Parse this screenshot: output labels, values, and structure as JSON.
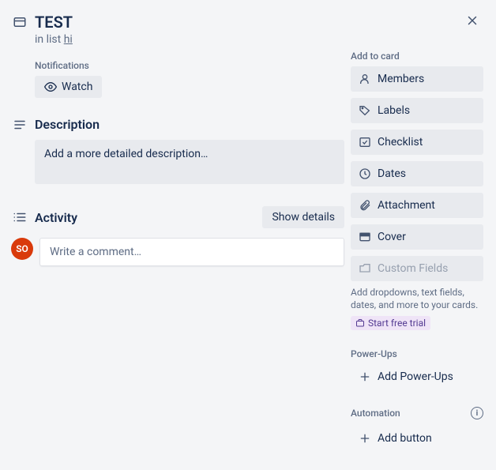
{
  "card": {
    "title": "TEST",
    "in_list_prefix": "in list ",
    "list_name": "hi"
  },
  "notifications": {
    "label": "Notifications",
    "watch": "Watch"
  },
  "description": {
    "heading": "Description",
    "placeholder": "Add a more detailed description…"
  },
  "activity": {
    "heading": "Activity",
    "show_details": "Show details",
    "avatar_initials": "SO",
    "comment_placeholder": "Write a comment…"
  },
  "sidebar": {
    "add_to_card": "Add to card",
    "items": [
      {
        "label": "Members"
      },
      {
        "label": "Labels"
      },
      {
        "label": "Checklist"
      },
      {
        "label": "Dates"
      },
      {
        "label": "Attachment"
      },
      {
        "label": "Cover"
      },
      {
        "label": "Custom Fields"
      }
    ],
    "custom_fields_hint": "Add dropdowns, text fields, dates, and more to your cards.",
    "start_trial": "Start free trial",
    "powerups_label": "Power-Ups",
    "add_powerups": "Add Power-Ups",
    "automation_label": "Automation",
    "add_button": "Add button"
  }
}
